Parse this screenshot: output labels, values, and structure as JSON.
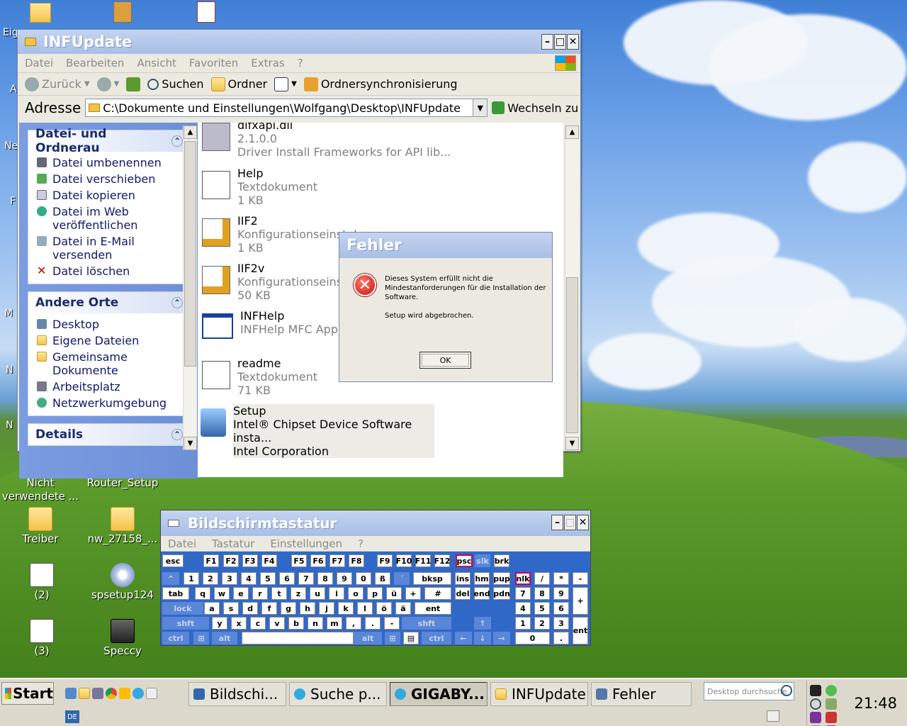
{
  "desktop": {
    "icons": [
      {
        "label": "Nicht verwendete ...",
        "kind": "folder"
      },
      {
        "label": "Router_Setup",
        "kind": "chrome"
      },
      {
        "label": "Treiber",
        "kind": "folder"
      },
      {
        "label": "nw_27158_...",
        "kind": "folder"
      },
      {
        "label": "(2)",
        "kind": "doc"
      },
      {
        "label": "spsetup124",
        "kind": "disc"
      },
      {
        "label": "(3)",
        "kind": "doc"
      },
      {
        "label": "Speccy",
        "kind": "speccy"
      }
    ],
    "edge_labels": [
      "Eig",
      "A",
      "Ne",
      "F",
      "M",
      "N",
      "N"
    ]
  },
  "explorer": {
    "title": "INFUpdate",
    "menu": [
      "Datei",
      "Bearbeiten",
      "Ansicht",
      "Favoriten",
      "Extras",
      "?"
    ],
    "toolbar": {
      "back": "Zurück",
      "search": "Suchen",
      "folders": "Ordner",
      "sync": "Ordnersynchronisierung"
    },
    "address_label": "Adresse",
    "address_value": "C:\\Dokumente und Einstellungen\\Wolfgang\\Desktop\\INFUpdate",
    "go_label": "Wechseln zu",
    "tasks_title": "Datei- und Ordnerau",
    "tasks": [
      "Datei umbenennen",
      "Datei verschieben",
      "Datei kopieren",
      "Datei im Web veröffentlichen",
      "Datei in E-Mail versenden",
      "Datei löschen"
    ],
    "places_title": "Andere Orte",
    "places": [
      "Desktop",
      "Eigene Dateien",
      "Gemeinsame Dokumente",
      "Arbeitsplatz",
      "Netzwerkumgebung"
    ],
    "details_title": "Details",
    "files": [
      {
        "name": "difxapi.dll",
        "line1": "2.1.0.0",
        "line2": "Driver Install Frameworks for API lib..."
      },
      {
        "name": "Help",
        "line1": "Textdokument",
        "line2": "1 KB"
      },
      {
        "name": "IIF2",
        "line1": "Konfigurationseinstel",
        "line2": "1 KB"
      },
      {
        "name": "IIF2v",
        "line1": "Konfigurationseinstel",
        "line2": "50 KB"
      },
      {
        "name": "INFHelp",
        "line1": "INFHelp MFC Applic",
        "line2": ""
      },
      {
        "name": "readme",
        "line1": "Textdokument",
        "line2": "71 KB"
      },
      {
        "name": "Setup",
        "line1": "Intel® Chipset Device Software insta...",
        "line2": "Intel Corporation"
      }
    ]
  },
  "dialog": {
    "title": "Fehler",
    "message": "Dieses System erfüllt nicht die Mindestanforderungen für die Installation der Software.",
    "message2": "Setup wird abgebrochen.",
    "ok": "OK"
  },
  "osk": {
    "title": "Bildschirmtastatur",
    "menu": [
      "Datei",
      "Tastatur",
      "Einstellungen",
      "?"
    ]
  },
  "taskbar": {
    "start": "Start",
    "tasks": [
      "Bildschi...",
      "Suche p...",
      "GIGABY...",
      "INFUpdate",
      "Fehler"
    ],
    "search_placeholder": "Desktop durchsuche",
    "lang": "DE",
    "clock": "21:48"
  }
}
